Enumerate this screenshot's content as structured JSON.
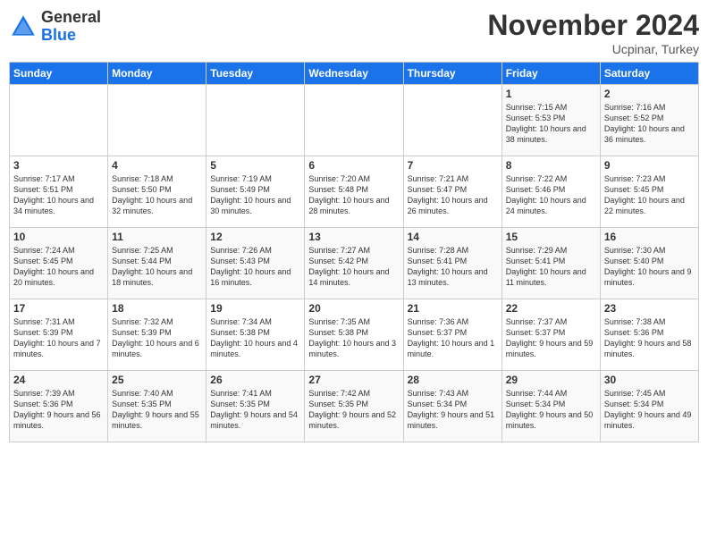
{
  "logo": {
    "general": "General",
    "blue": "Blue"
  },
  "title": "November 2024",
  "location": "Ucpinar, Turkey",
  "days_of_week": [
    "Sunday",
    "Monday",
    "Tuesday",
    "Wednesday",
    "Thursday",
    "Friday",
    "Saturday"
  ],
  "weeks": [
    {
      "days": [
        {
          "num": "",
          "info": ""
        },
        {
          "num": "",
          "info": ""
        },
        {
          "num": "",
          "info": ""
        },
        {
          "num": "",
          "info": ""
        },
        {
          "num": "",
          "info": ""
        },
        {
          "num": "1",
          "info": "Sunrise: 7:15 AM\nSunset: 5:53 PM\nDaylight: 10 hours and 38 minutes."
        },
        {
          "num": "2",
          "info": "Sunrise: 7:16 AM\nSunset: 5:52 PM\nDaylight: 10 hours and 36 minutes."
        }
      ]
    },
    {
      "days": [
        {
          "num": "3",
          "info": "Sunrise: 7:17 AM\nSunset: 5:51 PM\nDaylight: 10 hours and 34 minutes."
        },
        {
          "num": "4",
          "info": "Sunrise: 7:18 AM\nSunset: 5:50 PM\nDaylight: 10 hours and 32 minutes."
        },
        {
          "num": "5",
          "info": "Sunrise: 7:19 AM\nSunset: 5:49 PM\nDaylight: 10 hours and 30 minutes."
        },
        {
          "num": "6",
          "info": "Sunrise: 7:20 AM\nSunset: 5:48 PM\nDaylight: 10 hours and 28 minutes."
        },
        {
          "num": "7",
          "info": "Sunrise: 7:21 AM\nSunset: 5:47 PM\nDaylight: 10 hours and 26 minutes."
        },
        {
          "num": "8",
          "info": "Sunrise: 7:22 AM\nSunset: 5:46 PM\nDaylight: 10 hours and 24 minutes."
        },
        {
          "num": "9",
          "info": "Sunrise: 7:23 AM\nSunset: 5:45 PM\nDaylight: 10 hours and 22 minutes."
        }
      ]
    },
    {
      "days": [
        {
          "num": "10",
          "info": "Sunrise: 7:24 AM\nSunset: 5:45 PM\nDaylight: 10 hours and 20 minutes."
        },
        {
          "num": "11",
          "info": "Sunrise: 7:25 AM\nSunset: 5:44 PM\nDaylight: 10 hours and 18 minutes."
        },
        {
          "num": "12",
          "info": "Sunrise: 7:26 AM\nSunset: 5:43 PM\nDaylight: 10 hours and 16 minutes."
        },
        {
          "num": "13",
          "info": "Sunrise: 7:27 AM\nSunset: 5:42 PM\nDaylight: 10 hours and 14 minutes."
        },
        {
          "num": "14",
          "info": "Sunrise: 7:28 AM\nSunset: 5:41 PM\nDaylight: 10 hours and 13 minutes."
        },
        {
          "num": "15",
          "info": "Sunrise: 7:29 AM\nSunset: 5:41 PM\nDaylight: 10 hours and 11 minutes."
        },
        {
          "num": "16",
          "info": "Sunrise: 7:30 AM\nSunset: 5:40 PM\nDaylight: 10 hours and 9 minutes."
        }
      ]
    },
    {
      "days": [
        {
          "num": "17",
          "info": "Sunrise: 7:31 AM\nSunset: 5:39 PM\nDaylight: 10 hours and 7 minutes."
        },
        {
          "num": "18",
          "info": "Sunrise: 7:32 AM\nSunset: 5:39 PM\nDaylight: 10 hours and 6 minutes."
        },
        {
          "num": "19",
          "info": "Sunrise: 7:34 AM\nSunset: 5:38 PM\nDaylight: 10 hours and 4 minutes."
        },
        {
          "num": "20",
          "info": "Sunrise: 7:35 AM\nSunset: 5:38 PM\nDaylight: 10 hours and 3 minutes."
        },
        {
          "num": "21",
          "info": "Sunrise: 7:36 AM\nSunset: 5:37 PM\nDaylight: 10 hours and 1 minute."
        },
        {
          "num": "22",
          "info": "Sunrise: 7:37 AM\nSunset: 5:37 PM\nDaylight: 9 hours and 59 minutes."
        },
        {
          "num": "23",
          "info": "Sunrise: 7:38 AM\nSunset: 5:36 PM\nDaylight: 9 hours and 58 minutes."
        }
      ]
    },
    {
      "days": [
        {
          "num": "24",
          "info": "Sunrise: 7:39 AM\nSunset: 5:36 PM\nDaylight: 9 hours and 56 minutes."
        },
        {
          "num": "25",
          "info": "Sunrise: 7:40 AM\nSunset: 5:35 PM\nDaylight: 9 hours and 55 minutes."
        },
        {
          "num": "26",
          "info": "Sunrise: 7:41 AM\nSunset: 5:35 PM\nDaylight: 9 hours and 54 minutes."
        },
        {
          "num": "27",
          "info": "Sunrise: 7:42 AM\nSunset: 5:35 PM\nDaylight: 9 hours and 52 minutes."
        },
        {
          "num": "28",
          "info": "Sunrise: 7:43 AM\nSunset: 5:34 PM\nDaylight: 9 hours and 51 minutes."
        },
        {
          "num": "29",
          "info": "Sunrise: 7:44 AM\nSunset: 5:34 PM\nDaylight: 9 hours and 50 minutes."
        },
        {
          "num": "30",
          "info": "Sunrise: 7:45 AM\nSunset: 5:34 PM\nDaylight: 9 hours and 49 minutes."
        }
      ]
    }
  ]
}
